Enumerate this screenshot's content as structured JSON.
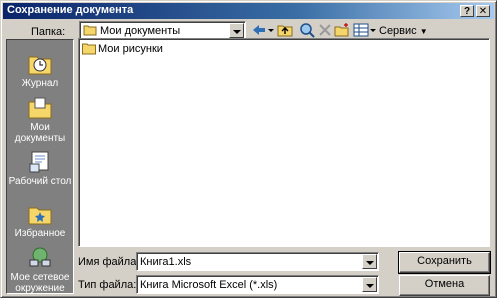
{
  "window": {
    "title": "Сохранение документа",
    "help_button": "?",
    "close_button": "✕"
  },
  "folder": {
    "label": "Папка:",
    "current": "Мои документы"
  },
  "toolbar": {
    "back_icon": "back-arrow-icon",
    "up_icon": "folder-up-icon",
    "search_icon": "search-web-icon",
    "delete_icon": "delete-icon",
    "new_folder_icon": "new-folder-icon",
    "views_icon": "views-icon",
    "tools_label": "Сервис"
  },
  "places": [
    {
      "label": "Журнал",
      "icon": "history-icon"
    },
    {
      "label": "Мои документы",
      "icon": "my-documents-icon"
    },
    {
      "label": "Рабочий стол",
      "icon": "desktop-icon"
    },
    {
      "label": "Избранное",
      "icon": "favorites-icon"
    },
    {
      "label": "Мое сетевое окружение",
      "icon": "network-places-icon"
    }
  ],
  "files": [
    {
      "name": "Мои рисунки",
      "icon": "folder-icon"
    }
  ],
  "filename": {
    "label": "Имя файла:",
    "value": "Книга1.xls"
  },
  "filetype": {
    "label": "Тип файла:",
    "value": "Книга Microsoft Excel (*.xls)"
  },
  "buttons": {
    "save": "Сохранить",
    "cancel": "Отмена"
  },
  "colors": {
    "title_start": "#0a246a",
    "title_end": "#a6caf0",
    "face": "#d4d0c8",
    "places_bg": "#808080"
  }
}
